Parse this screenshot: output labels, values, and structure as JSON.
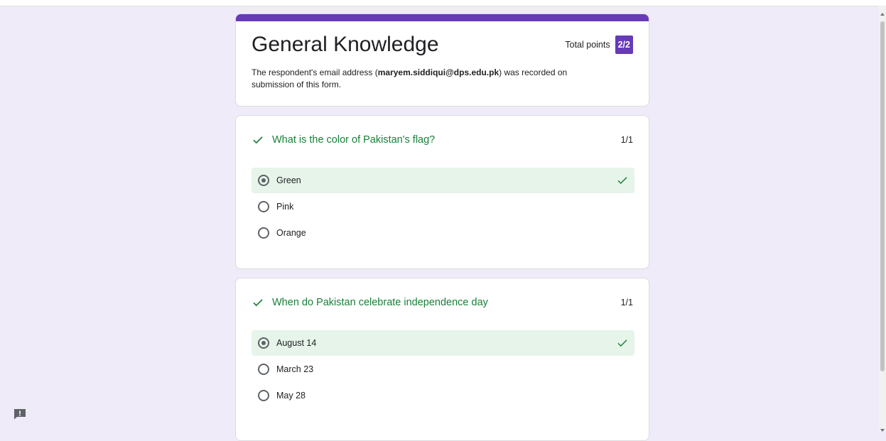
{
  "form": {
    "title": "General Knowledge",
    "total_points_label": "Total points",
    "total_points_value": "2/2",
    "email_prefix": "The respondent's email address (",
    "email": "maryem.siddiqui@dps.edu.pk",
    "email_suffix": ") was recorded on submission of this form.",
    "accent_color": "#673ab7"
  },
  "questions": [
    {
      "title": "What is the color of Pakistan's flag?",
      "score": "1/1",
      "options": [
        {
          "label": "Green",
          "selected": true,
          "correct": true
        },
        {
          "label": "Pink",
          "selected": false,
          "correct": false
        },
        {
          "label": "Orange",
          "selected": false,
          "correct": false
        }
      ]
    },
    {
      "title": "When do Pakistan celebrate independence day",
      "score": "1/1",
      "options": [
        {
          "label": "August 14",
          "selected": true,
          "correct": true
        },
        {
          "label": "March 23",
          "selected": false,
          "correct": false
        },
        {
          "label": "May 28",
          "selected": false,
          "correct": false
        }
      ]
    }
  ],
  "icons": {
    "correct": "check-icon",
    "feedback": "feedback-icon"
  },
  "colors": {
    "correct_text": "#188038",
    "correct_bg": "#e6f4ea",
    "page_bg": "#f0ebf8"
  }
}
